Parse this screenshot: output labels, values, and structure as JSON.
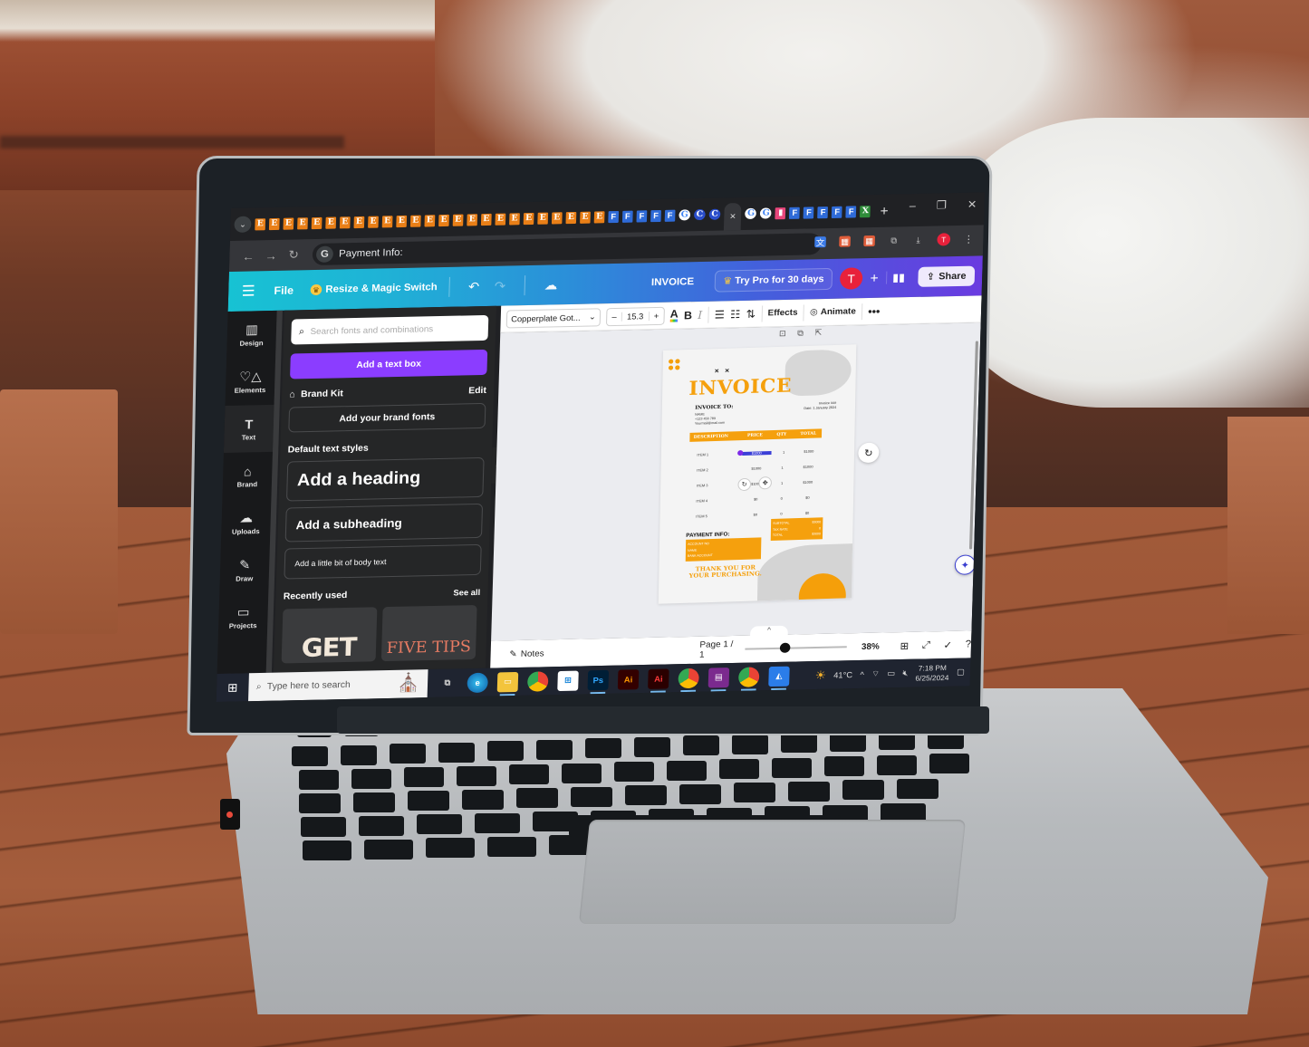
{
  "browser": {
    "tab_favicons": {
      "orange_E_count": 25,
      "orange_label": "E",
      "blue_label": "F",
      "blue_F_count_before_active": 5,
      "blue_F_count_after_active": 5
    },
    "active_tab_close": "×",
    "new_tab": "+",
    "window_controls": {
      "minimize": "–",
      "restore": "❐",
      "close": "✕"
    },
    "nav": {
      "back": "←",
      "forward": "→",
      "reload": "↻"
    },
    "address_bar": {
      "site_badge": "G",
      "text": "Payment Info:"
    },
    "profile_initial": "T",
    "menu": "⋮"
  },
  "canva_header": {
    "menu_icon": "☰",
    "file_label": "File",
    "magic_switch_label": "Resize & Magic Switch",
    "document_title": "INVOICE",
    "try_pro_label": "Try Pro for 30 days",
    "avatar_initial": "T",
    "add_label": "+",
    "share_label": "Share"
  },
  "left_rail": {
    "items": [
      {
        "label": "Design",
        "icon": "▥"
      },
      {
        "label": "Elements",
        "icon": "♡△"
      },
      {
        "label": "Text",
        "icon": "T"
      },
      {
        "label": "Brand",
        "icon": "⌂"
      },
      {
        "label": "Uploads",
        "icon": "☁"
      },
      {
        "label": "Draw",
        "icon": "✎"
      },
      {
        "label": "Projects",
        "icon": "▭"
      }
    ],
    "active": "Text"
  },
  "text_panel": {
    "search_placeholder": "Search fonts and combinations",
    "add_text_box": "Add a text box",
    "brand_kit_label": "Brand Kit",
    "brand_kit_edit": "Edit",
    "add_brand_fonts": "Add your brand fonts",
    "default_styles_label": "Default text styles",
    "heading": "Add a heading",
    "subheading": "Add a subheading",
    "body": "Add a little bit of body text",
    "recently_used_label": "Recently used",
    "see_all": "See all",
    "recent_thumbs": [
      "GET",
      "FIVE TIPS"
    ]
  },
  "toolbar": {
    "font_name": "Copperplate Got...",
    "font_size": "15.3",
    "decrease": "–",
    "increase": "+",
    "color_label": "A",
    "bold": "B",
    "italic": "I",
    "effects": "Effects",
    "animate": "Animate",
    "more": "•••"
  },
  "invoice": {
    "title": "INVOICE",
    "marks": "× ×",
    "invoice_to_label": "INVOICE TO:",
    "invoice_to_lines": [
      "NAME",
      "+123 456 789",
      "Yourmail@mail.com"
    ],
    "meta_lines": [
      "Invoice ###",
      "Date: 1 January 2024"
    ],
    "columns": [
      "DESCRIPTION",
      "PRICE",
      "QTY",
      "TOTAL"
    ],
    "rows": [
      [
        "ITEM 1",
        "$1000",
        "1",
        "$1000"
      ],
      [
        "ITEM 2",
        "$1000",
        "1",
        "$1000"
      ],
      [
        "ITEM 3",
        "$1000",
        "1",
        "$1000"
      ],
      [
        "ITEM 4",
        "$0",
        "0",
        "$0"
      ],
      [
        "ITEM 5",
        "$0",
        "0",
        "$0"
      ]
    ],
    "payment_title": "PAYMENT INFO:",
    "payment_lines": [
      "ACCOUNT NO",
      "NAME",
      "BANK ACCOUNT"
    ],
    "summary": [
      [
        "SUBTOTAL",
        "$3000"
      ],
      [
        "TAX RATE",
        "0"
      ],
      [
        "TOTAL",
        "$3000"
      ]
    ],
    "thanks_lines": [
      "THANK YOU FOR",
      "YOUR PURCHASING."
    ],
    "accent_color": "#f5a00d"
  },
  "footer": {
    "notes_label": "Notes",
    "page_indicator": "Page 1 / 1",
    "zoom_percent": 38,
    "zoom_label": "38%",
    "expand_caret": "^"
  },
  "taskbar": {
    "search_placeholder": "Type here to search",
    "apps": [
      "Task View",
      "Edge",
      "File Explorer",
      "Chrome",
      "Microsoft Store",
      "Photoshop",
      "Illustrator",
      "Illustrator",
      "Chrome (profile)",
      "WinRAR",
      "Chrome",
      "Maps"
    ],
    "weather": "41°C",
    "time": "7:18 PM",
    "date": "6/25/2024"
  }
}
